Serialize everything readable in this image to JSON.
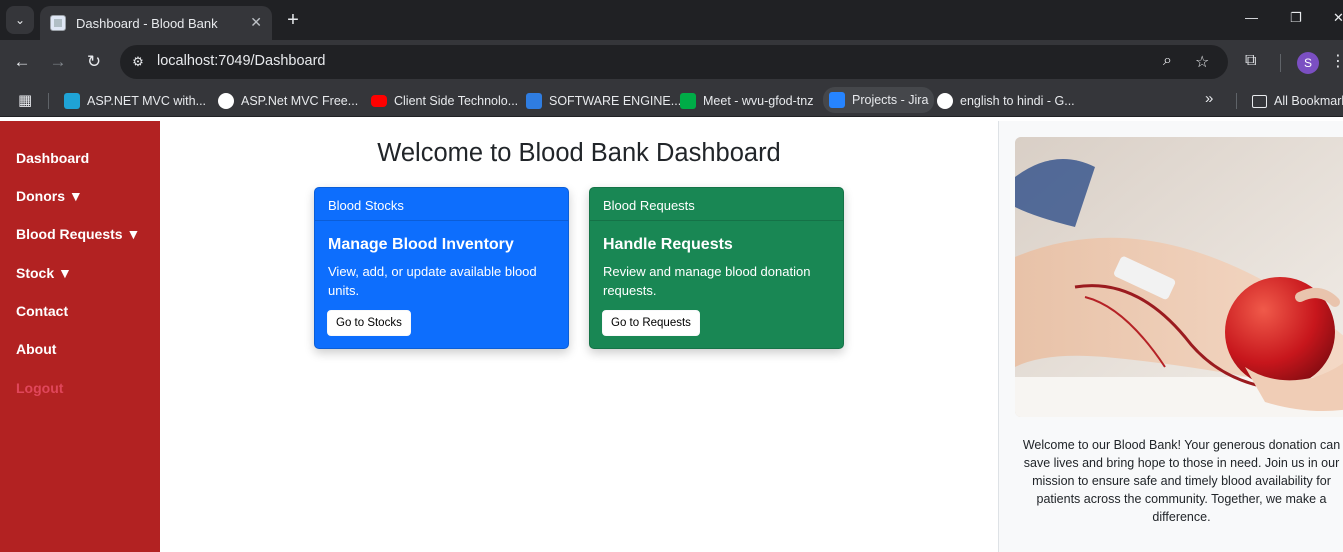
{
  "browser": {
    "tab_title": "Dashboard - Blood Bank",
    "url": "localhost:7049/Dashboard",
    "profile_initial": "S",
    "bookmarks": [
      {
        "label": "ASP.NET MVC with...",
        "color": "#1fa3d6"
      },
      {
        "label": "ASP.Net MVC Free...",
        "color": "#ffffff"
      },
      {
        "label": "Client Side Technolo...",
        "color": "#ff0000"
      },
      {
        "label": "SOFTWARE ENGINE...",
        "color": "#2f7de1"
      },
      {
        "label": "Meet - wvu-gfod-tnz",
        "color": "#00ac47"
      },
      {
        "label": "Projects - Jira",
        "color": "#2684ff"
      },
      {
        "label": "english to hindi - G...",
        "color": "#ffffff"
      }
    ],
    "all_bookmarks": "All Bookmarks"
  },
  "sidebar": {
    "items": [
      {
        "label": "Dashboard"
      },
      {
        "label": "Donors ▼"
      },
      {
        "label": "Blood Requests ▼"
      },
      {
        "label": "Stock ▼"
      },
      {
        "label": "Contact"
      },
      {
        "label": "About"
      },
      {
        "label": "Logout"
      }
    ],
    "background": "#b22222"
  },
  "main": {
    "title": "Welcome to Blood Bank Dashboard",
    "cards": [
      {
        "header": "Blood Stocks",
        "title": "Manage Blood Inventory",
        "text": "View, add, or update available blood units.",
        "button": "Go to Stocks",
        "color": "#0d6efd"
      },
      {
        "header": "Blood Requests",
        "title": "Handle Requests",
        "text": "Review and manage blood donation requests.",
        "button": "Go to Requests",
        "color": "#198754"
      }
    ]
  },
  "aside": {
    "welcome_text": "Welcome to our Blood Bank! Your generous donation can save lives and bring hope to those in need. Join us in our mission to ensure safe and timely blood availability for patients across the community. Together, we make a difference."
  }
}
